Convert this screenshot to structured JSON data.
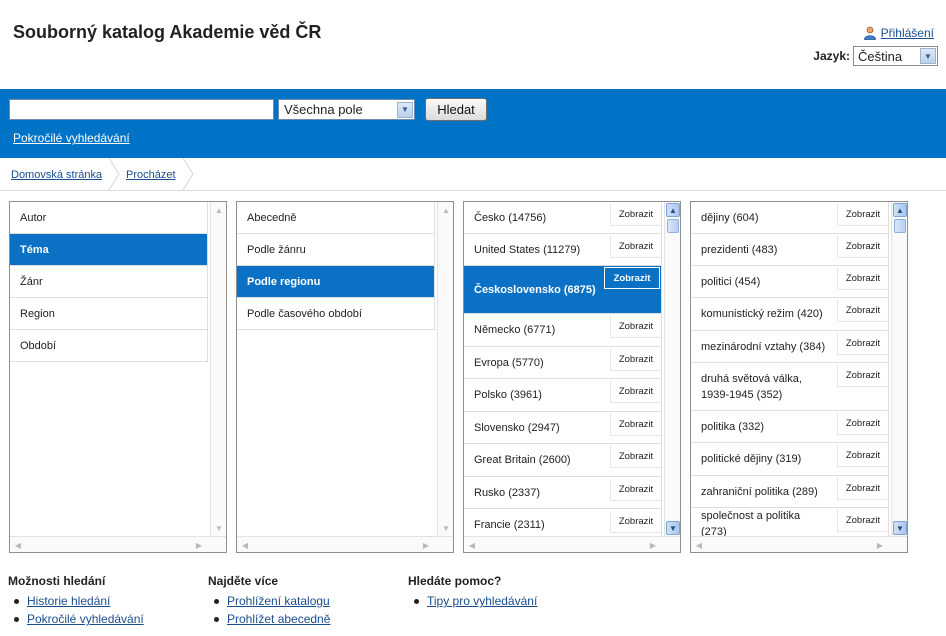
{
  "header": {
    "title": "Souborný katalog Akademie věd ČR",
    "login_label": "Přihlášení",
    "language_label": "Jazyk:",
    "language_value": "Čeština"
  },
  "search": {
    "query_value": "",
    "field_value": "Všechna pole",
    "button_label": "Hledat",
    "advanced_link": "Pokročilé vyhledávání"
  },
  "breadcrumb": [
    "Domovská stránka",
    "Procházet"
  ],
  "columns": {
    "col1": {
      "items": [
        "Autor",
        "Téma",
        "Žánr",
        "Region",
        "Období"
      ],
      "selected": 1
    },
    "col2": {
      "items": [
        "Abecedně",
        "Podle žánru",
        "Podle regionu",
        "Podle časového období"
      ],
      "selected": 2
    },
    "col3": {
      "show_label": "Zobrazit",
      "selected": 2,
      "items": [
        "Česko (14756)",
        "United States (11279)",
        "Československo (6875)",
        "Německo (6771)",
        "Evropa (5770)",
        "Polsko (3961)",
        "Slovensko (2947)",
        "Great Britain (2600)",
        "Rusko (2337)",
        "Francie (2311)"
      ]
    },
    "col4": {
      "show_label": "Zobrazit",
      "items": [
        "dějiny (604)",
        "prezidenti (483)",
        "politici (454)",
        "komunistický režim (420)",
        "mezinárodní vztahy (384)",
        "druhá světová válka, 1939-1945 (352)",
        "politika (332)",
        "politické dějiny (319)",
        "zahraniční politika (289)",
        "společnost a politika (273)"
      ]
    }
  },
  "footer": {
    "col1": {
      "heading": "Možnosti hledání",
      "links": [
        "Historie hledání",
        "Pokročilé vyhledávání"
      ]
    },
    "col2": {
      "heading": "Najděte více",
      "links": [
        "Prohlížení katalogu",
        "Prohlížet abecedně"
      ]
    },
    "col3": {
      "heading": "Hledáte pomoc?",
      "links": [
        "Tipy pro vyhledávání"
      ]
    }
  }
}
